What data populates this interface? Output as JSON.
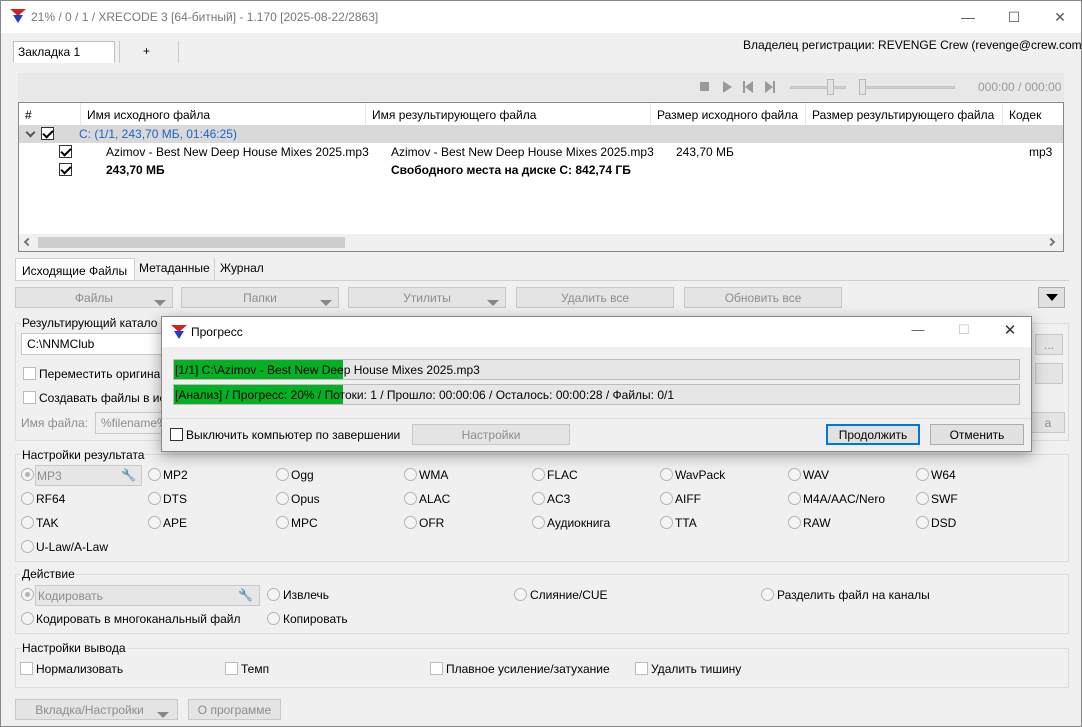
{
  "window": {
    "title": "21% / 0 / 1 / XRECODE 3 [64-битный] - 1.170 [2025-08-22/2863]",
    "minimize": "—",
    "maximize": "☐",
    "close": "✕"
  },
  "tabs": {
    "tab1": "Закладка 1",
    "add": "+"
  },
  "registration": "Владелец регистрации: REVENGE Crew (revenge@crew.com)",
  "player": {
    "time": "000:00 / 000:00"
  },
  "table": {
    "columns": [
      "#",
      "Имя исходного файла",
      "Имя результирующего файла",
      "Размер исходного файла",
      "Размер результирующего файла",
      "Кодек"
    ],
    "group_label": "C: (1/1, 243,70 МБ, 01:46:25)",
    "row": {
      "source": "Azimov - Best New Deep House Mixes 2025.mp3",
      "result": "Azimov - Best New Deep House Mixes 2025.mp3",
      "size": "243,70 МБ",
      "codec": "mp3"
    },
    "summary": {
      "total": "243,70 МБ",
      "free": "Свободного места на диске C: 842,74 ГБ"
    }
  },
  "bottom_tabs": [
    "Исходящие Файлы",
    "Метаданные",
    "Журнал"
  ],
  "toolbar": {
    "files": "Файлы",
    "folders": "Папки",
    "utilities": "Утилиты",
    "delete_all": "Удалить все",
    "refresh_all": "Обновить все"
  },
  "output_dir": {
    "label": "Результирующий катало",
    "value": "C:\\NNMClub",
    "browse": "...",
    "move_original": "Переместить оригина",
    "create_files": "Создавать файлы в ис",
    "filename_label": "Имя файла:",
    "filename_value": "%filename%",
    "side_btn": "а"
  },
  "result_settings": {
    "title": "Настройки результата",
    "formats": [
      [
        "MP3",
        "MP2",
        "Ogg",
        "WMA",
        "FLAC",
        "WavPack",
        "WAV",
        "W64"
      ],
      [
        "RF64",
        "DTS",
        "Opus",
        "ALAC",
        "AC3",
        "AIFF",
        "M4A/AAC/Nero",
        "SWF"
      ],
      [
        "TAK",
        "APE",
        "MPC",
        "OFR",
        "Аудиокнига",
        "TTA",
        "RAW",
        "DSD"
      ],
      [
        "U-Law/A-Law"
      ]
    ]
  },
  "action": {
    "title": "Действие",
    "encode": "Кодировать",
    "extract": "Извлечь",
    "merge": "Слияние/CUE",
    "split": "Разделить файл на каналы",
    "multichannel": "Кодировать в многоканальный файл",
    "copy": "Копировать"
  },
  "output_settings": {
    "title": "Настройки вывода",
    "normalize": "Нормализовать",
    "tempo": "Темп",
    "fade": "Плавное усиление/затухание",
    "silence": "Удалить тишину"
  },
  "footer": {
    "tab_settings": "Вкладка/Настройки",
    "about": "О программе"
  },
  "dialog": {
    "title": "Прогресс",
    "file_progress_text": "[1/1] C:\\Azimov - Best New Deep House Mixes 2025.mp3",
    "file_progress": 0.2,
    "total_progress_text": "[Анализ] / Прогресс: 20% / Потоки: 1 / Прошло: 00:00:06 / Осталось: 00:00:28 / Файлы: 0/1",
    "total_progress": 0.2,
    "shutdown": "Выключить компьютер по завершении",
    "settings": "Настройки",
    "continue": "Продолжить",
    "cancel": "Отменить"
  },
  "colors": {
    "progress_fill": "#06b025",
    "group_text": "#1e64c8",
    "accent": "#0078d7"
  }
}
